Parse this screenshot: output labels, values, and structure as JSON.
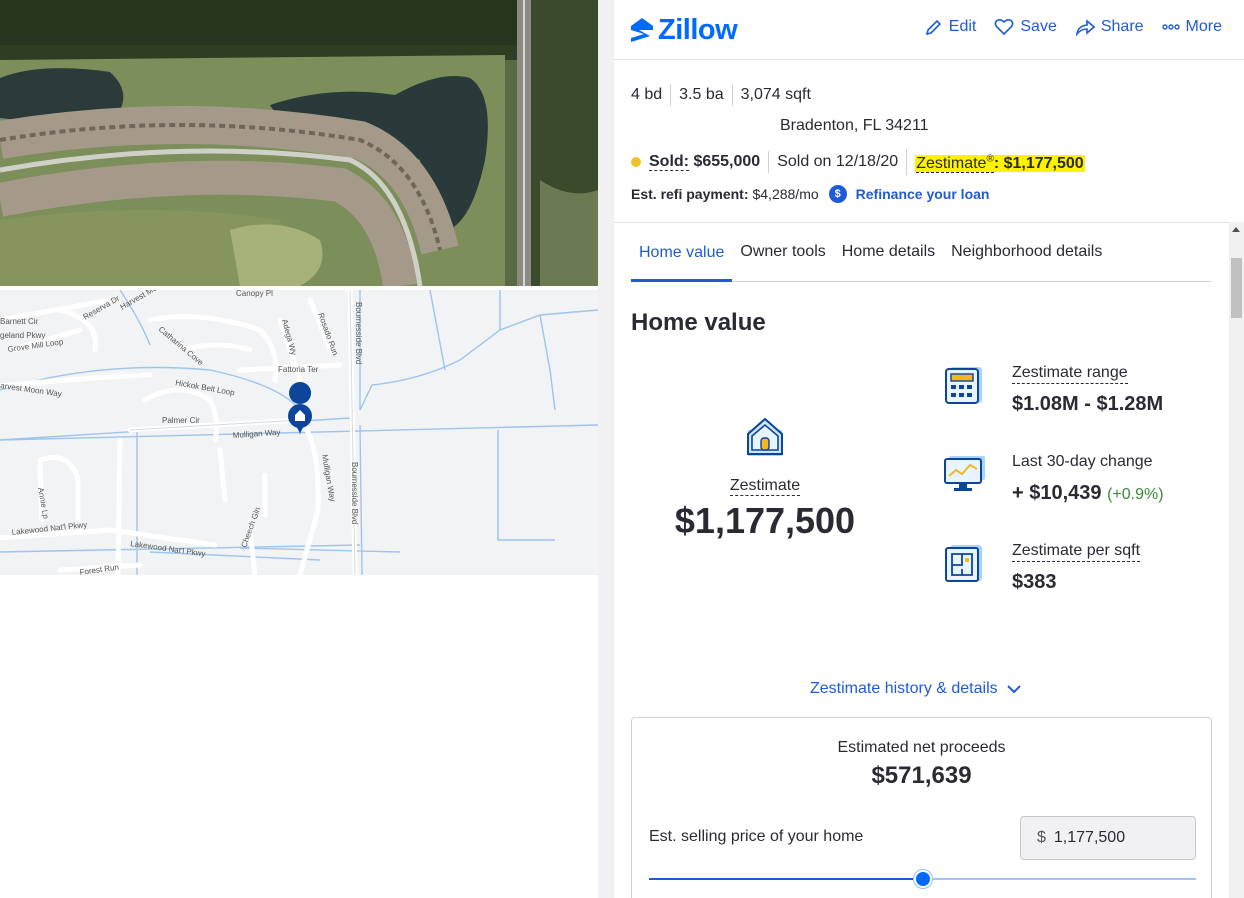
{
  "brand": {
    "name": "Zillow",
    "color": "#006aff"
  },
  "toolbar": {
    "edit_label": "Edit",
    "save_label": "Save",
    "share_label": "Share",
    "more_label": "More"
  },
  "summary": {
    "beds": "4 bd",
    "baths": "3.5 ba",
    "sqft": "3,074 sqft",
    "address": "Bradenton, FL 34211",
    "status_label": "Sold:",
    "status_value": "$655,000",
    "sold_on": "Sold on 12/18/20",
    "zestimate_label": "Zestimate",
    "zestimate_sup": "®",
    "zestimate_value": ": $1,177,500"
  },
  "refi": {
    "label": "Est. refi payment:",
    "value": "$4,288/mo",
    "icon": "dollar-icon",
    "link": "Refinance your loan"
  },
  "tabs": [
    {
      "label": "Home value",
      "active": true
    },
    {
      "label": "Owner tools",
      "active": false
    },
    {
      "label": "Home details",
      "active": false
    },
    {
      "label": "Neighborhood details",
      "active": false
    }
  ],
  "home_value": {
    "title": "Home value",
    "zestimate_label": "Zestimate",
    "zestimate_value": "$1,177,500",
    "stats": [
      {
        "icon": "calculator-icon",
        "label": "Zestimate range",
        "value": "$1.08M - $1.28M"
      },
      {
        "icon": "monitor-chart-icon",
        "label": "Last 30-day change",
        "value": "+ $10,439",
        "change_pct": "(+0.9%)"
      },
      {
        "icon": "floorplan-icon",
        "label": "Zestimate per sqft",
        "value": "$383"
      }
    ],
    "history_link": "Zestimate history & details"
  },
  "proceeds": {
    "title": "Estimated net proceeds",
    "value": "$571,639",
    "price_label": "Est. selling price of your home",
    "currency": "$",
    "price_value": "1,177,500",
    "slider_fraction": 0.5
  },
  "map": {
    "labels": [
      "Barnett Cir",
      "Reserva Dr",
      "Harvest Moon",
      "Canopy Pl",
      "geland Pkwy",
      "Grove Mill Loop",
      "Catharina Cove",
      "Adega Wy",
      "Rosado Run",
      "Bournesside Blvd",
      "Fattoria Ter",
      "arvest Moon Way",
      "Hickok Belt Loop",
      "Palmer Cir",
      "Mulligan Way",
      "Mulligan Way",
      "Annie Lp",
      "Lakewood Nat'l Pkwy",
      "Lakewood Nat'l Pkwy",
      "Cheech Gln",
      "Forest Run",
      "Bournesside Blvd"
    ]
  }
}
